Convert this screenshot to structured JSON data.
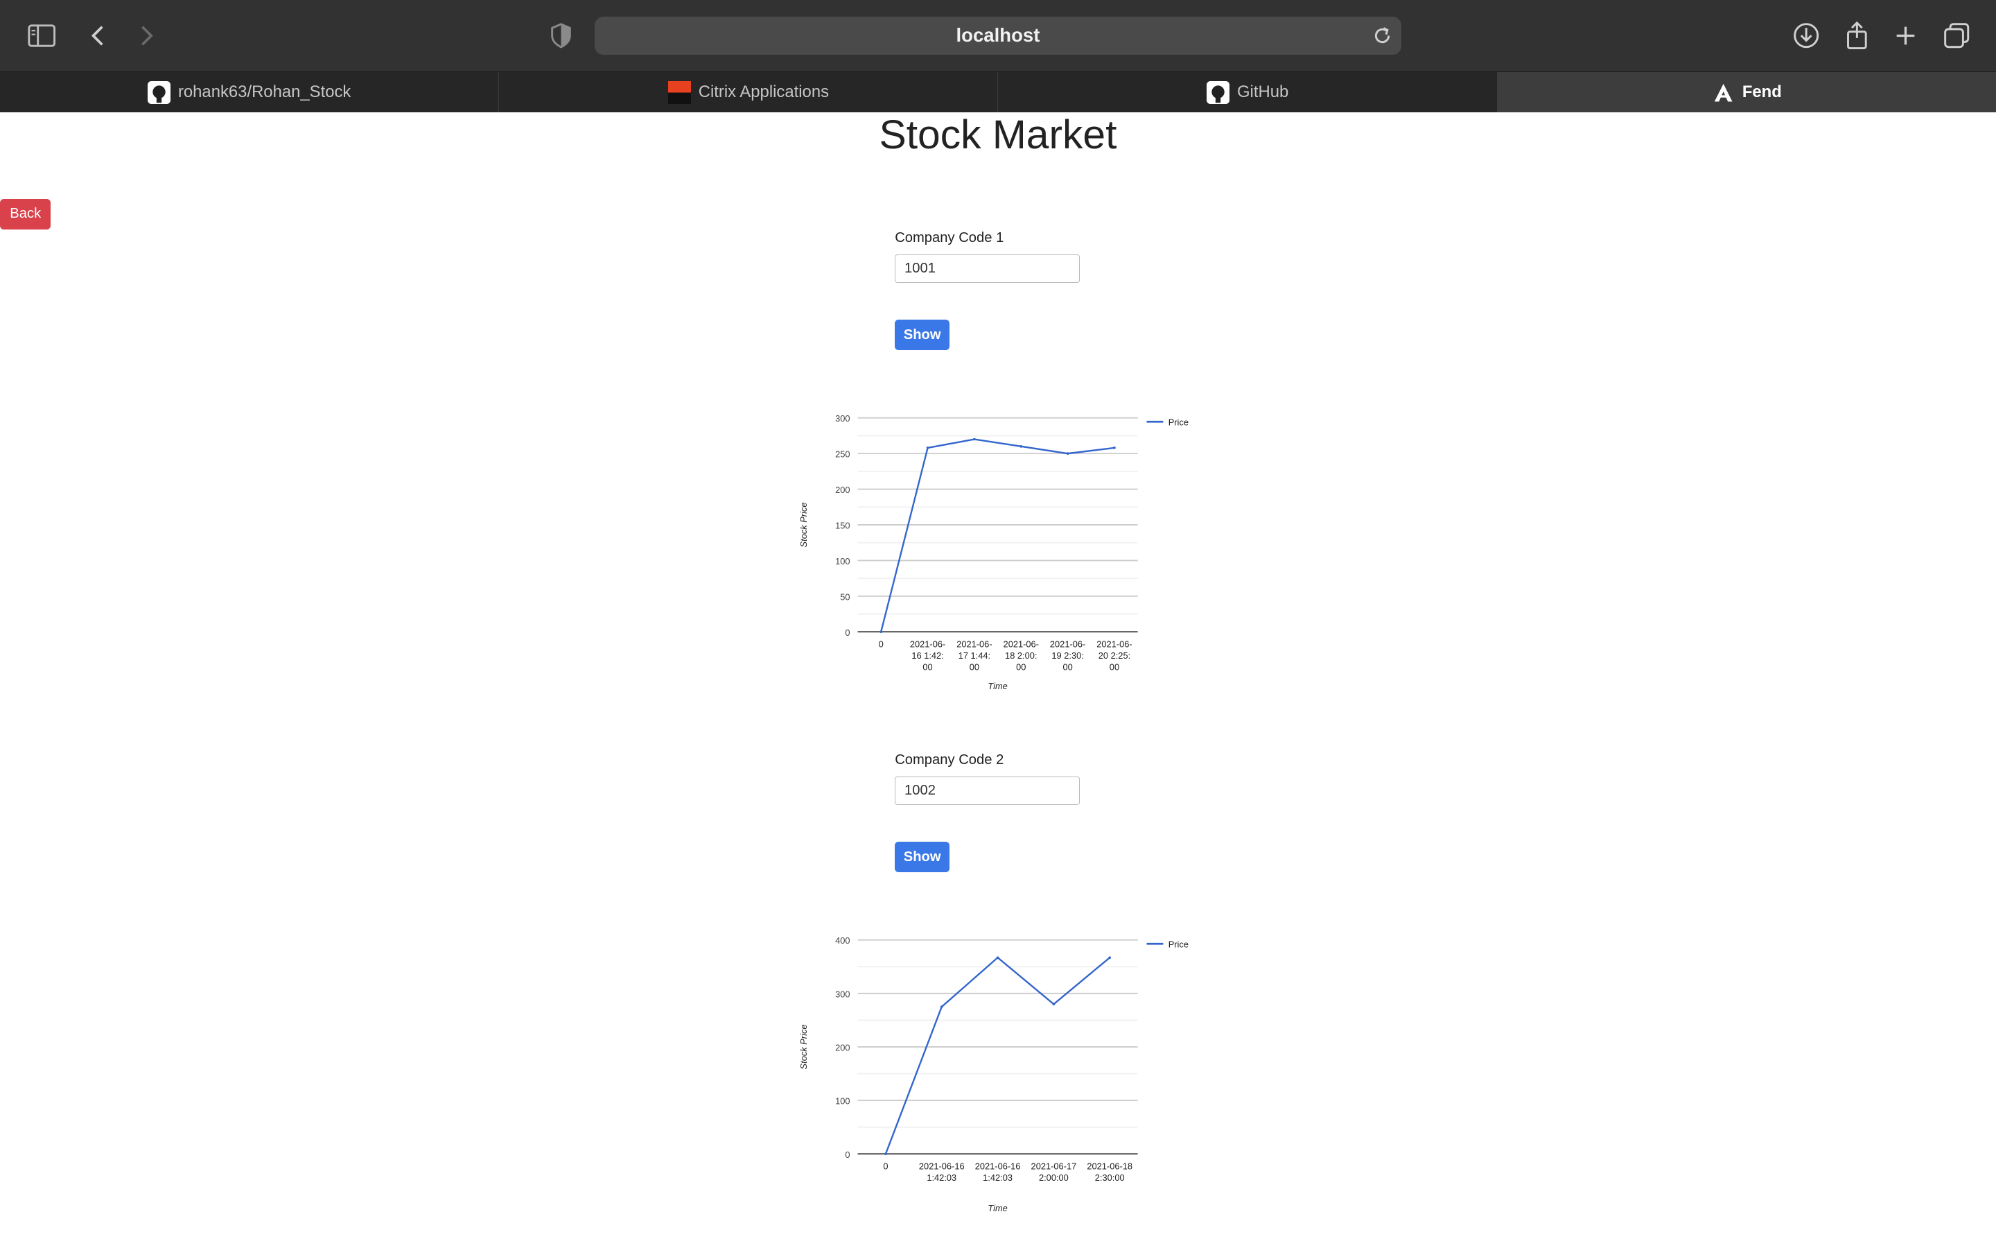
{
  "browser": {
    "url": "localhost",
    "tabs": [
      {
        "label": "rohank63/Rohan_Stock",
        "icon": "github-icon",
        "active": false
      },
      {
        "label": "Citrix Applications",
        "icon": "citrix-icon",
        "active": false
      },
      {
        "label": "GitHub",
        "icon": "github-icon",
        "active": false
      },
      {
        "label": "Fend",
        "icon": "angular-icon",
        "active": true
      }
    ]
  },
  "page": {
    "title": "Stock Market",
    "back_label": "Back",
    "company1": {
      "label": "Company Code 1",
      "value": "1001",
      "button": "Show"
    },
    "company2": {
      "label": "Company Code 2",
      "value": "1002",
      "button": "Show"
    }
  },
  "colors": {
    "line": "#3366cc",
    "show_button": "#3b78e7",
    "back_button": "#d9414b"
  },
  "chart_data": [
    {
      "type": "line",
      "categories": [
        [
          "0"
        ],
        [
          "2021-06-",
          "16 1:42:",
          "00"
        ],
        [
          "2021-06-",
          "17 1:44:",
          "00"
        ],
        [
          "2021-06-",
          "18 2:00:",
          "00"
        ],
        [
          "2021-06-",
          "19 2:30:",
          "00"
        ],
        [
          "2021-06-",
          "20 2:25:",
          "00"
        ]
      ],
      "series": [
        {
          "name": "Price",
          "values": [
            0,
            258,
            270,
            260,
            250,
            258
          ]
        }
      ],
      "xlabel": "Time",
      "ylabel": "Stock Price",
      "ylim": [
        0,
        300
      ],
      "yticks": [
        0,
        50,
        100,
        150,
        200,
        250,
        300
      ],
      "legend": "top-right",
      "grid": true
    },
    {
      "type": "line",
      "categories": [
        [
          "0"
        ],
        [
          "2021-06-16",
          "1:42:03"
        ],
        [
          "2021-06-16",
          "1:42:03"
        ],
        [
          "2021-06-17",
          "2:00:00"
        ],
        [
          "2021-06-18",
          "2:30:00"
        ]
      ],
      "series": [
        {
          "name": "Price",
          "values": [
            0,
            275,
            367,
            280,
            367
          ]
        }
      ],
      "xlabel": "Time",
      "ylabel": "Stock Price",
      "ylim": [
        0,
        400
      ],
      "yticks": [
        0,
        100,
        200,
        300,
        400
      ],
      "legend": "top-right",
      "grid": true
    }
  ]
}
